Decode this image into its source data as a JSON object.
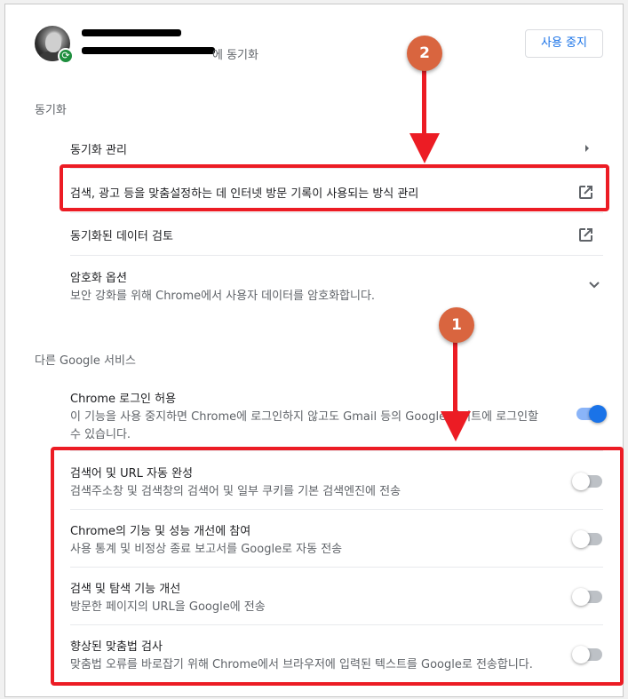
{
  "account": {
    "sub_suffix": "에 동기화",
    "stop_button": "사용 중지"
  },
  "sync": {
    "section_title": "동기화",
    "rows": [
      {
        "title": "동기화 관리",
        "icon": "chevron-right-icon"
      },
      {
        "title": "검색, 광고 등을 맞춤설정하는 데 인터넷 방문 기록이 사용되는 방식 관리",
        "icon": "open-in-new-icon"
      },
      {
        "title": "동기화된 데이터 검토",
        "icon": "open-in-new-icon"
      },
      {
        "title": "암호화 옵션",
        "subtitle": "보안 강화를 위해 Chrome에서 사용자 데이터를 암호화합니다.",
        "icon": "chevron-down-icon"
      }
    ]
  },
  "google_services": {
    "section_title": "다른 Google 서비스",
    "rows": [
      {
        "title": "Chrome 로그인 허용",
        "subtitle_line1": "이 기능을 사용 중지하면 Chrome에 로그인하지 않고도 Gmail 등의 Google 사이트에 로그인할",
        "subtitle_line2": "수 있습니다.",
        "toggle": true
      },
      {
        "title": "검색어 및 URL 자동 완성",
        "subtitle": "검색주소창 및 검색창의 검색어 및 일부 쿠키를 기본 검색엔진에 전송",
        "toggle": false
      },
      {
        "title": "Chrome의 기능 및 성능 개선에 참여",
        "subtitle": "사용 통계 및 비정상 종료 보고서를 Google로 자동 전송",
        "toggle": false
      },
      {
        "title": "검색 및 탐색 기능 개선",
        "subtitle": "방문한 페이지의 URL을 Google에 전송",
        "toggle": false
      },
      {
        "title": "향상된 맞춤법 검사",
        "subtitle": "맞춤법 오류를 바로잡기 위해 Chrome에서 브라우저에 입력된 텍스트를 Google로 전송합니다.",
        "toggle": false
      }
    ]
  },
  "annotations": {
    "badge_1": "1",
    "badge_2": "2",
    "highlight_color": "#ec1c24",
    "badge_color": "#d9653f"
  },
  "colors": {
    "accent": "#1a73e8",
    "toggle_on_track": "#8ab4f8",
    "toggle_off_track": "#bdc1c6"
  }
}
